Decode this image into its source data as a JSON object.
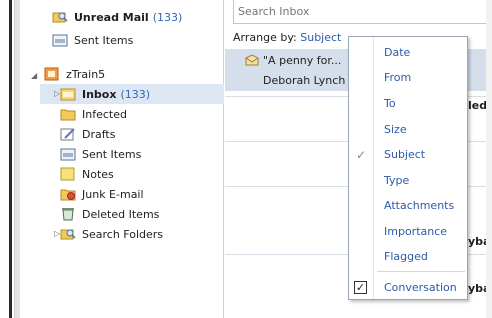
{
  "folders": {
    "unread_mail": {
      "label": "Unread Mail",
      "count": "(133)"
    },
    "sent_items_top": {
      "label": "Sent Items"
    },
    "account": {
      "label": "zTrain5"
    },
    "inbox": {
      "label": "Inbox",
      "count": "(133)"
    },
    "infected": {
      "label": "Infected"
    },
    "drafts": {
      "label": "Drafts"
    },
    "sent_items": {
      "label": "Sent Items"
    },
    "notes": {
      "label": "Notes"
    },
    "junk": {
      "label": "Junk E-mail"
    },
    "deleted": {
      "label": "Deleted Items"
    },
    "search_folders": {
      "label": "Search Folders"
    }
  },
  "message_pane": {
    "search_placeholder": "Search Inbox",
    "arrange_label": "Arrange by:",
    "arrange_value": "Subject",
    "message_subject": "\"A penny for...",
    "message_sender": "Deborah Lynch",
    "fragments": [
      "led",
      "yba",
      "yba"
    ]
  },
  "arrange_menu": {
    "items": [
      {
        "label": "Date"
      },
      {
        "label": "From"
      },
      {
        "label": "To"
      },
      {
        "label": "Size"
      },
      {
        "label": "Subject"
      },
      {
        "label": "Type"
      },
      {
        "label": "Attachments"
      },
      {
        "label": "Importance"
      },
      {
        "label": "Flagged"
      },
      {
        "label": "Conversation"
      }
    ],
    "checked": "Subject",
    "conversation_checked": true
  },
  "colors": {
    "accent": "#2c5ba8",
    "count_blue": "#3568b0",
    "selection": "#dde7f3",
    "message_highlight": "#d5dfec"
  }
}
